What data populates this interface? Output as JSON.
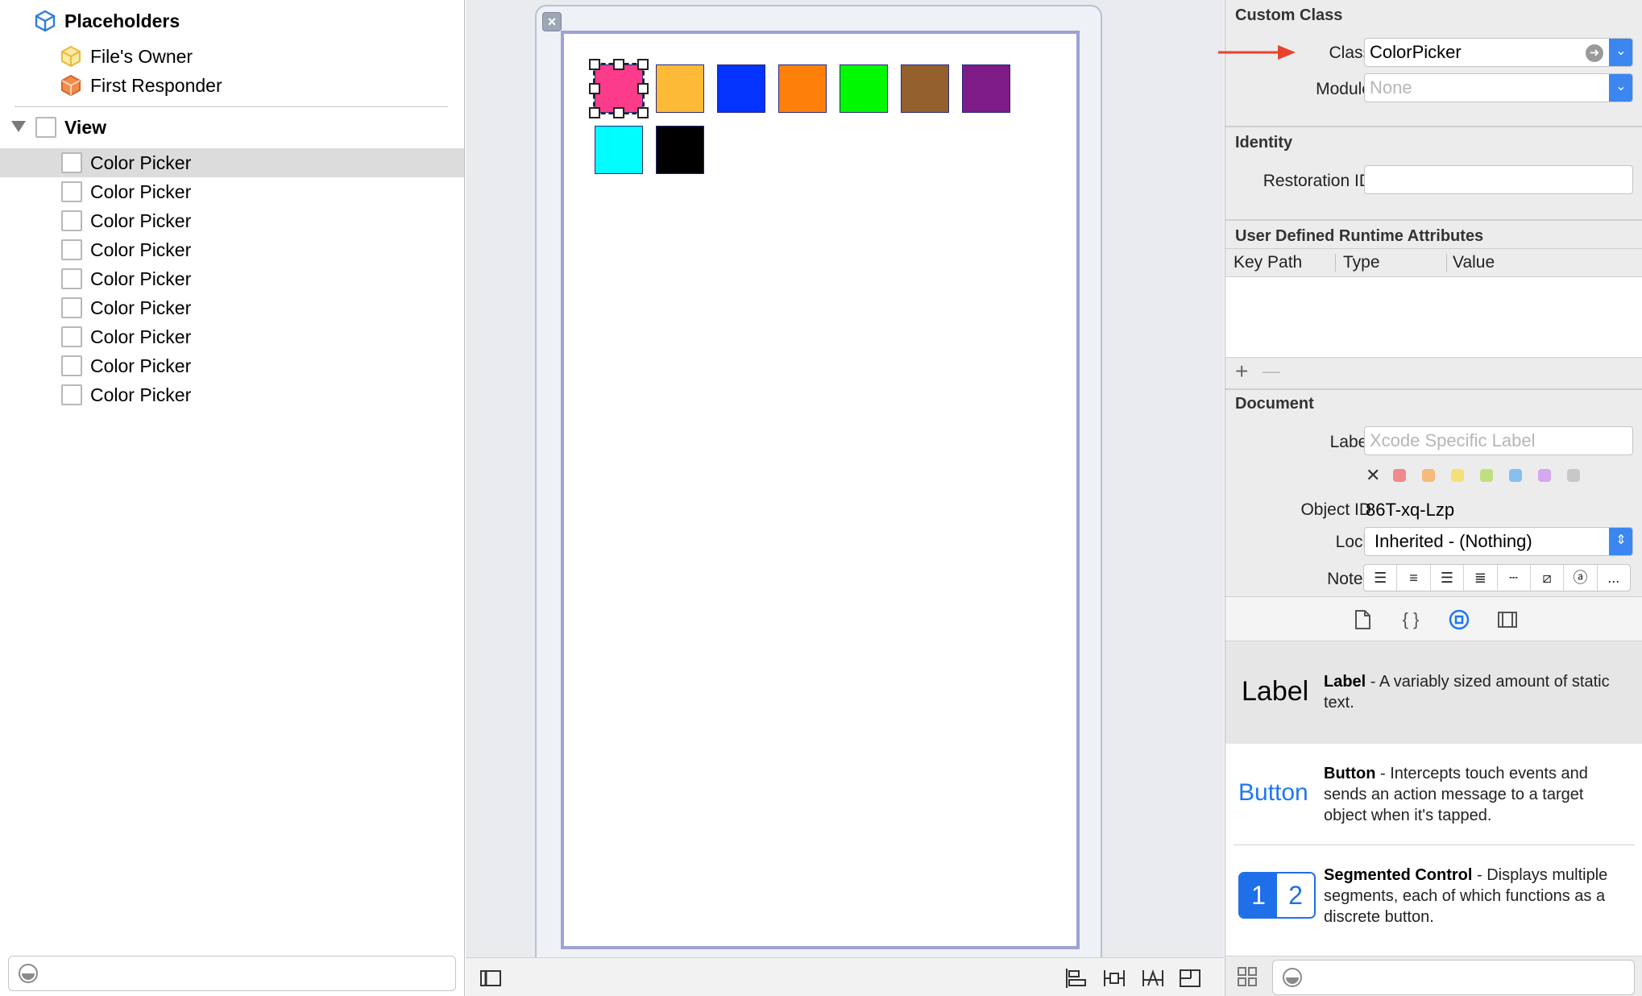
{
  "outline": {
    "placeholders_label": "Placeholders",
    "files_owner_label": "File's Owner",
    "first_responder_label": "First Responder",
    "view_label": "View",
    "color_pickers": [
      "Color Picker",
      "Color Picker",
      "Color Picker",
      "Color Picker",
      "Color Picker",
      "Color Picker",
      "Color Picker",
      "Color Picker",
      "Color Picker"
    ]
  },
  "canvas": {
    "swatches": [
      "#fc3c8a",
      "#fdba37",
      "#0433ff",
      "#ff7f0b",
      "#00f900",
      "#93602e",
      "#7e1b86",
      "#00fdff",
      "#000000"
    ]
  },
  "inspector": {
    "custom_class": {
      "title": "Custom Class",
      "class_label": "Class",
      "class_value": "ColorPicker",
      "module_label": "Module",
      "module_placeholder": "None"
    },
    "identity": {
      "title": "Identity",
      "restoration_label": "Restoration ID"
    },
    "runtime_attrs": {
      "title": "User Defined Runtime Attributes",
      "col_key_path": "Key Path",
      "col_type": "Type",
      "col_value": "Value",
      "add": "+",
      "remove": "—"
    },
    "document": {
      "title": "Document",
      "label_label": "Label",
      "label_placeholder": "Xcode Specific Label",
      "clear_color": "✕",
      "label_colors": [
        "#f08a8a",
        "#f6bb7a",
        "#f4e07a",
        "#bfe07e",
        "#86bff2",
        "#d4a8ee",
        "#c8c8c8"
      ],
      "object_id_label": "Object ID",
      "object_id_value": "86T-xq-Lzp",
      "lock_label": "Lock",
      "lock_value": "Inherited - (Nothing)",
      "notes_label": "Notes",
      "notes_more": "..."
    },
    "library": [
      {
        "preview": "Label",
        "title": "Label",
        "desc": " - A variably sized amount of static text."
      },
      {
        "preview": "Button",
        "title": "Button",
        "desc": " - Intercepts touch events and sends an action message to a target object when it's tapped."
      },
      {
        "seg1": "1",
        "seg2": "2",
        "title": "Segmented Control",
        "desc": " - Displays multiple segments, each of which functions as a discrete button."
      }
    ]
  },
  "colors": {
    "accent": "#3b86f0",
    "selection_arrow": "#e8412c"
  }
}
